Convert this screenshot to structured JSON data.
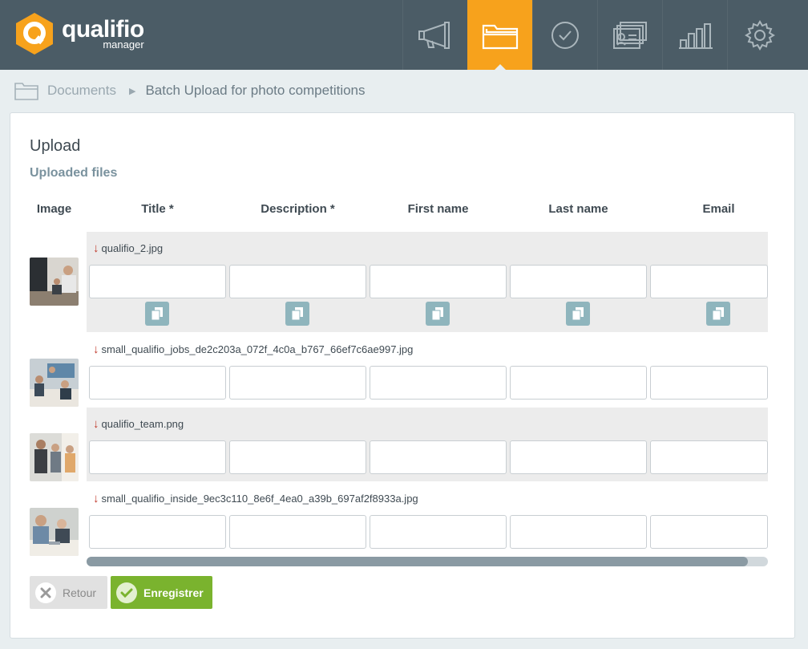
{
  "brand": {
    "name": "qualifio",
    "subtitle": "manager",
    "accent": "#f7a21c",
    "topbar_color": "#4b5c66"
  },
  "nav": [
    {
      "icon": "megaphone-icon",
      "active": false
    },
    {
      "icon": "folder-icon",
      "active": true
    },
    {
      "icon": "checkmark-circle-icon",
      "active": false
    },
    {
      "icon": "contact-cards-icon",
      "active": false
    },
    {
      "icon": "bar-chart-icon",
      "active": false
    },
    {
      "icon": "gear-icon",
      "active": false
    }
  ],
  "breadcrumb": {
    "root": "Documents",
    "current": "Batch Upload for photo competitions",
    "icon": "folder-icon"
  },
  "panel": {
    "title": "Upload",
    "section": "Uploaded files",
    "columns": [
      "Image",
      "Title *",
      "Description *",
      "First name",
      "Last name",
      "Email"
    ]
  },
  "rows": [
    {
      "filename": "qualifio_2.jpg",
      "values": [
        "",
        "",
        "",
        "",
        ""
      ]
    },
    {
      "filename": "small_qualifio_jobs_de2c203a_072f_4c0a_b767_66ef7c6ae997.jpg",
      "values": [
        "",
        "",
        "",
        "",
        ""
      ]
    },
    {
      "filename": "qualifio_team.png",
      "values": [
        "",
        "",
        "",
        "",
        ""
      ]
    },
    {
      "filename": "small_qualifio_inside_9ec3c110_8e6f_4ea0_a39b_697af2f8933a.jpg",
      "values": [
        "",
        "",
        "",
        "",
        ""
      ]
    }
  ],
  "scrollbar": {
    "position_fraction": 0.97
  },
  "buttons": {
    "back": "Retour",
    "save": "Enregistrer"
  }
}
